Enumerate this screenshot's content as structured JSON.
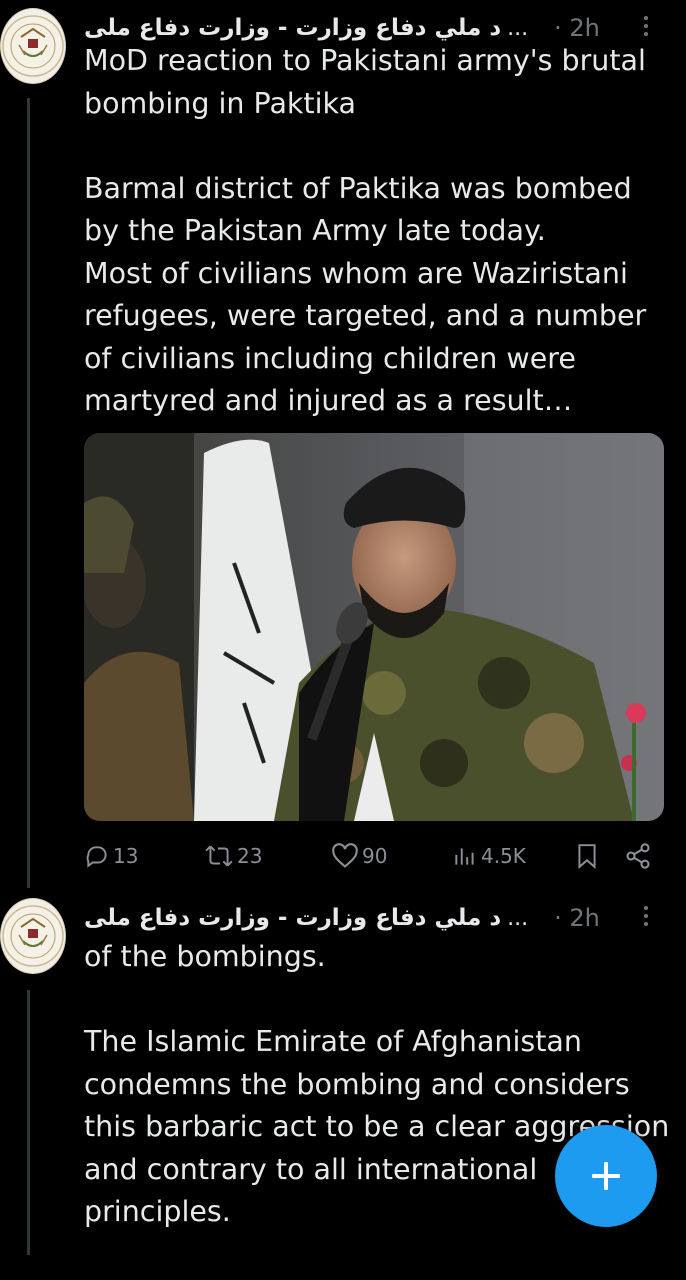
{
  "tweets": [
    {
      "author_name": "د ملي دفاع وزارت - وزارت دفاع ملی",
      "ellipsis": "...",
      "time": "· 2h",
      "text": "MoD reaction to Pakistani army's brutal bombing in Paktika\n\nBarmal district of Paktika was bombed by the Pakistan Army late today.\nMost of civilians whom are Waziristani refugees, were targeted, and a number of civilians including children were martyred and injured as a result…",
      "actions": {
        "replies": "13",
        "reposts": "23",
        "likes": "90",
        "views": "4.5K"
      }
    },
    {
      "author_name": "د ملي دفاع وزارت - وزارت دفاع ملی",
      "ellipsis": "...",
      "time": "· 2h",
      "text": "of the bombings.\n\nThe Islamic Emirate of Afghanistan condemns the bombing and considers this barbaric act to be a clear aggression and contrary to all international principles."
    }
  ],
  "icons": {
    "reply": "reply-icon",
    "repost": "repost-icon",
    "like": "heart-icon",
    "views": "views-icon",
    "bookmark": "bookmark-icon",
    "share": "share-icon",
    "more": "more-icon",
    "compose": "plus-icon"
  },
  "colors": {
    "background": "#000000",
    "text": "#e7e9ea",
    "secondary": "#71767b",
    "accent": "#1d9bf0"
  }
}
